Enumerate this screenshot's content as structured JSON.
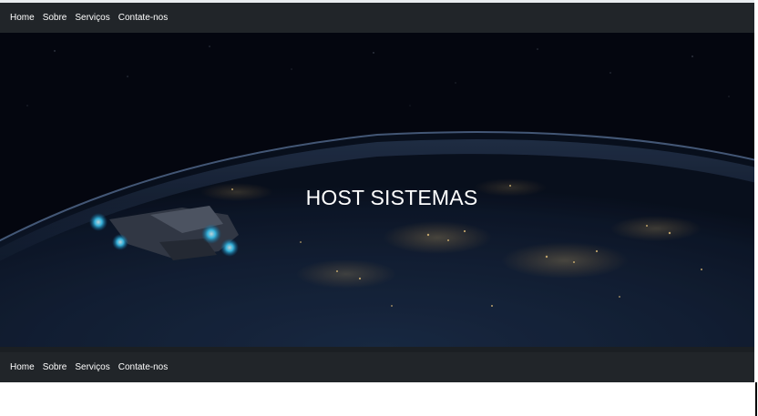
{
  "nav_top": {
    "items": [
      {
        "label": "Home"
      },
      {
        "label": "Sobre"
      },
      {
        "label": "Serviços"
      },
      {
        "label": "Contate-nos"
      }
    ]
  },
  "hero": {
    "title": "HOST SISTEMAS",
    "image": "earth-at-night-with-spaceship"
  },
  "nav_bottom": {
    "items": [
      {
        "label": "Home"
      },
      {
        "label": "Sobre"
      },
      {
        "label": "Serviços"
      },
      {
        "label": "Contate-nos"
      }
    ]
  },
  "colors": {
    "navbar_bg": "#212529",
    "nav_text": "#ffffff",
    "hero_bg": "#050812",
    "page_bg": "#ffffff"
  }
}
